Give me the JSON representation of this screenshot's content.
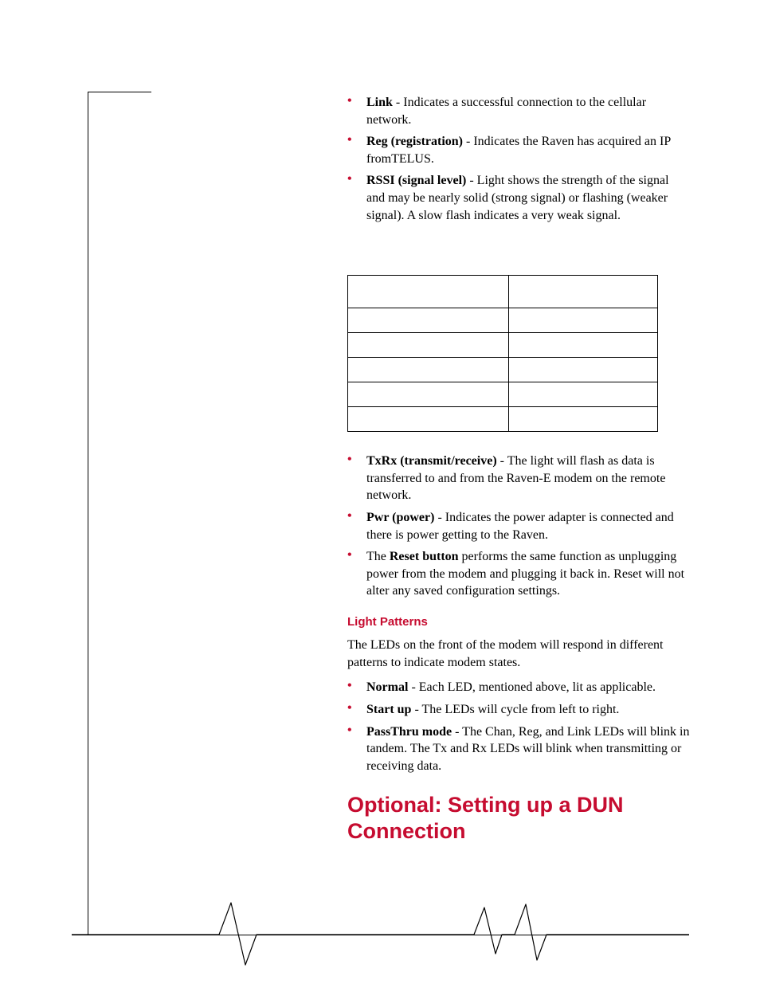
{
  "bullets_top": [
    {
      "term": "Link",
      "sep": " - ",
      "text": "Indicates a successful connection to the cellular network."
    },
    {
      "term": "Reg (registration)",
      "sep": " - ",
      "text": "Indicates the Raven has acquired an IP fromTELUS."
    },
    {
      "term": "RSSI (signal level)",
      "sep": " - ",
      "text": "Light shows the strength of the signal and may be nearly solid (strong signal) or flashing (weaker signal). A slow flash indicates a very weak signal."
    }
  ],
  "rssi_table": {
    "headers": [
      "",
      ""
    ],
    "rows": [
      [
        "",
        ""
      ],
      [
        "",
        ""
      ],
      [
        "",
        ""
      ],
      [
        "",
        ""
      ],
      [
        "",
        ""
      ]
    ]
  },
  "bullets_mid": [
    {
      "term": "TxRx (transmit/receive)",
      "sep": " - ",
      "text": "The light will flash as data is transferred to and from the Raven-E modem on the remote network."
    },
    {
      "term": "Pwr (power)",
      "sep": " - ",
      "text": "Indicates the power adapter is connected and there is power getting to the Raven."
    },
    {
      "term_prefix": "The ",
      "term": "Reset button",
      "sep": " ",
      "text": "performs the same function as unplugging power from the modem and plugging it back in. Reset will not alter any saved configuration settings."
    }
  ],
  "subhead": "Light Patterns",
  "para_intro": "The LEDs on the front of the modem will respond in different patterns to indicate modem states.",
  "bullets_patterns": [
    {
      "term": "Normal",
      "sep": " - ",
      "text": "Each LED, mentioned above, lit as applicable."
    },
    {
      "term": "Start up",
      "sep": " - ",
      "text": "The LEDs will cycle from left to right."
    },
    {
      "term": "PassThru mode",
      "sep": " - ",
      "text": "The Chan, Reg, and Link LEDs will blink in tandem. The Tx and Rx LEDs will blink when trans­mitting or receiving data."
    }
  ],
  "h1": "Optional: Setting up a DUN Connection",
  "graphics": {
    "wave_color": "#000000"
  }
}
